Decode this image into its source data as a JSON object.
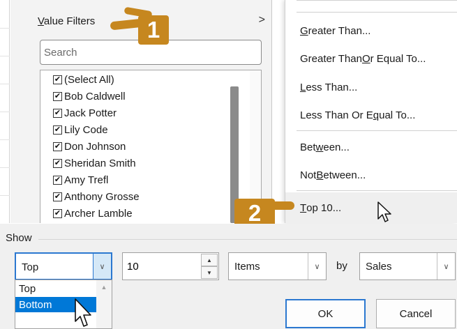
{
  "filter_panel": {
    "value_filters_label": "Value Filters",
    "submenu_arrow": ">",
    "search_placeholder": "Search",
    "names": [
      "(Select All)",
      "Bob Caldwell",
      "Jack Potter",
      "Lily Code",
      "Don Johnson",
      "Sheridan Smith",
      "Amy Trefl",
      "Anthony Grosse",
      "Archer Lamble"
    ],
    "checkbox_glyph": "✔"
  },
  "submenu": {
    "items": [
      {
        "pre": "",
        "acc": "G",
        "post": "reater Than..."
      },
      {
        "pre": "Greater Than ",
        "acc": "O",
        "post": "r Equal To..."
      },
      {
        "pre": "",
        "acc": "L",
        "post": "ess Than..."
      },
      {
        "pre": "Less Than Or E",
        "acc": "q",
        "post": "ual To..."
      },
      {
        "pre": "Bet",
        "acc": "w",
        "post": "een..."
      },
      {
        "pre": "Not ",
        "acc": "B",
        "post": "etween..."
      },
      {
        "pre": "",
        "acc": "T",
        "post": "op 10..."
      }
    ]
  },
  "callouts": {
    "one": "1",
    "two": "2"
  },
  "dialog": {
    "show_label": "Show",
    "top_combo_value": "Top",
    "count_value": "10",
    "items_combo_value": "Items",
    "by_label": "by",
    "field_combo_value": "Sales",
    "ok_label": "OK",
    "cancel_label": "Cancel",
    "dropdown_options": [
      "Top",
      "Bottom"
    ],
    "selected_option": "Bottom"
  },
  "colors": {
    "callout": "#c6871f",
    "selection": "#0078d7",
    "focus_border": "#2b78d0"
  },
  "icons": [
    "chevron-right-icon",
    "checkbox-icon",
    "chevron-down-icon",
    "spin-up-icon",
    "spin-down-icon",
    "mouse-cursor-icon"
  ]
}
